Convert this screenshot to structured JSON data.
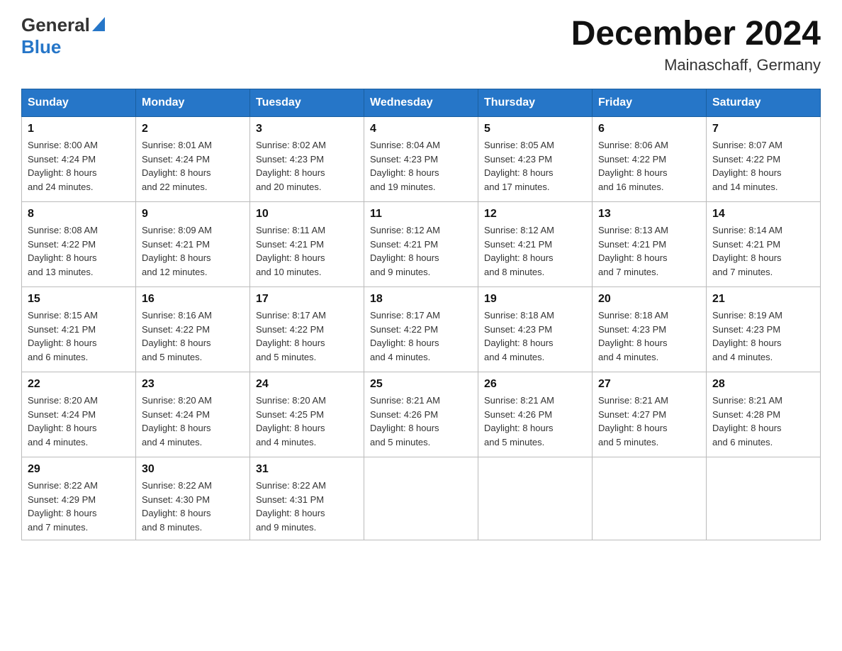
{
  "header": {
    "logo_general": "General",
    "logo_blue": "Blue",
    "month_title": "December 2024",
    "location": "Mainaschaff, Germany"
  },
  "days_of_week": [
    "Sunday",
    "Monday",
    "Tuesday",
    "Wednesday",
    "Thursday",
    "Friday",
    "Saturday"
  ],
  "weeks": [
    [
      {
        "day": "1",
        "sunrise": "8:00 AM",
        "sunset": "4:24 PM",
        "daylight": "8 hours and 24 minutes."
      },
      {
        "day": "2",
        "sunrise": "8:01 AM",
        "sunset": "4:24 PM",
        "daylight": "8 hours and 22 minutes."
      },
      {
        "day": "3",
        "sunrise": "8:02 AM",
        "sunset": "4:23 PM",
        "daylight": "8 hours and 20 minutes."
      },
      {
        "day": "4",
        "sunrise": "8:04 AM",
        "sunset": "4:23 PM",
        "daylight": "8 hours and 19 minutes."
      },
      {
        "day": "5",
        "sunrise": "8:05 AM",
        "sunset": "4:23 PM",
        "daylight": "8 hours and 17 minutes."
      },
      {
        "day": "6",
        "sunrise": "8:06 AM",
        "sunset": "4:22 PM",
        "daylight": "8 hours and 16 minutes."
      },
      {
        "day": "7",
        "sunrise": "8:07 AM",
        "sunset": "4:22 PM",
        "daylight": "8 hours and 14 minutes."
      }
    ],
    [
      {
        "day": "8",
        "sunrise": "8:08 AM",
        "sunset": "4:22 PM",
        "daylight": "8 hours and 13 minutes."
      },
      {
        "day": "9",
        "sunrise": "8:09 AM",
        "sunset": "4:21 PM",
        "daylight": "8 hours and 12 minutes."
      },
      {
        "day": "10",
        "sunrise": "8:11 AM",
        "sunset": "4:21 PM",
        "daylight": "8 hours and 10 minutes."
      },
      {
        "day": "11",
        "sunrise": "8:12 AM",
        "sunset": "4:21 PM",
        "daylight": "8 hours and 9 minutes."
      },
      {
        "day": "12",
        "sunrise": "8:12 AM",
        "sunset": "4:21 PM",
        "daylight": "8 hours and 8 minutes."
      },
      {
        "day": "13",
        "sunrise": "8:13 AM",
        "sunset": "4:21 PM",
        "daylight": "8 hours and 7 minutes."
      },
      {
        "day": "14",
        "sunrise": "8:14 AM",
        "sunset": "4:21 PM",
        "daylight": "8 hours and 7 minutes."
      }
    ],
    [
      {
        "day": "15",
        "sunrise": "8:15 AM",
        "sunset": "4:21 PM",
        "daylight": "8 hours and 6 minutes."
      },
      {
        "day": "16",
        "sunrise": "8:16 AM",
        "sunset": "4:22 PM",
        "daylight": "8 hours and 5 minutes."
      },
      {
        "day": "17",
        "sunrise": "8:17 AM",
        "sunset": "4:22 PM",
        "daylight": "8 hours and 5 minutes."
      },
      {
        "day": "18",
        "sunrise": "8:17 AM",
        "sunset": "4:22 PM",
        "daylight": "8 hours and 4 minutes."
      },
      {
        "day": "19",
        "sunrise": "8:18 AM",
        "sunset": "4:23 PM",
        "daylight": "8 hours and 4 minutes."
      },
      {
        "day": "20",
        "sunrise": "8:18 AM",
        "sunset": "4:23 PM",
        "daylight": "8 hours and 4 minutes."
      },
      {
        "day": "21",
        "sunrise": "8:19 AM",
        "sunset": "4:23 PM",
        "daylight": "8 hours and 4 minutes."
      }
    ],
    [
      {
        "day": "22",
        "sunrise": "8:20 AM",
        "sunset": "4:24 PM",
        "daylight": "8 hours and 4 minutes."
      },
      {
        "day": "23",
        "sunrise": "8:20 AM",
        "sunset": "4:24 PM",
        "daylight": "8 hours and 4 minutes."
      },
      {
        "day": "24",
        "sunrise": "8:20 AM",
        "sunset": "4:25 PM",
        "daylight": "8 hours and 4 minutes."
      },
      {
        "day": "25",
        "sunrise": "8:21 AM",
        "sunset": "4:26 PM",
        "daylight": "8 hours and 5 minutes."
      },
      {
        "day": "26",
        "sunrise": "8:21 AM",
        "sunset": "4:26 PM",
        "daylight": "8 hours and 5 minutes."
      },
      {
        "day": "27",
        "sunrise": "8:21 AM",
        "sunset": "4:27 PM",
        "daylight": "8 hours and 5 minutes."
      },
      {
        "day": "28",
        "sunrise": "8:21 AM",
        "sunset": "4:28 PM",
        "daylight": "8 hours and 6 minutes."
      }
    ],
    [
      {
        "day": "29",
        "sunrise": "8:22 AM",
        "sunset": "4:29 PM",
        "daylight": "8 hours and 7 minutes."
      },
      {
        "day": "30",
        "sunrise": "8:22 AM",
        "sunset": "4:30 PM",
        "daylight": "8 hours and 8 minutes."
      },
      {
        "day": "31",
        "sunrise": "8:22 AM",
        "sunset": "4:31 PM",
        "daylight": "8 hours and 9 minutes."
      },
      null,
      null,
      null,
      null
    ]
  ],
  "labels": {
    "sunrise": "Sunrise:",
    "sunset": "Sunset:",
    "daylight": "Daylight:"
  }
}
